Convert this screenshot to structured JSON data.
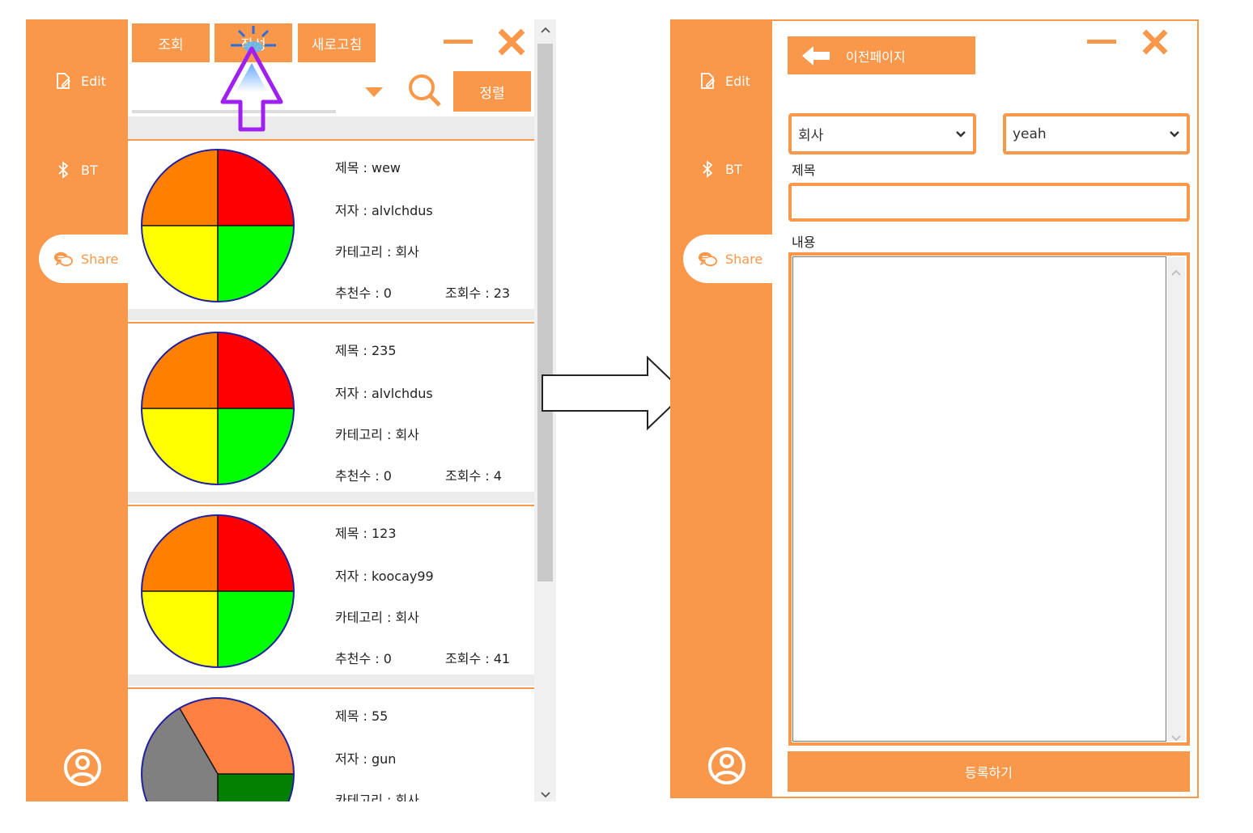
{
  "sidebar": {
    "items": [
      {
        "label": "Edit",
        "icon": "edit-icon"
      },
      {
        "label": "BT",
        "icon": "bluetooth-icon"
      },
      {
        "label": "Share",
        "icon": "chat-icon"
      }
    ]
  },
  "left_window": {
    "toolbar": {
      "view_label": "조회",
      "write_label": "작성",
      "refresh_label": "새로고침",
      "sort_label": "정렬"
    },
    "posts": [
      {
        "title": "제목 : wew",
        "author": "저자 : alvlchdus",
        "category": "카테고리 : 회사",
        "likes": "추천수 : 0",
        "views": "조회수 : 23"
      },
      {
        "title": "제목 : 235",
        "author": "저자 : alvlchdus",
        "category": "카테고리 : 회사",
        "likes": "추천수 : 0",
        "views": "조회수 : 4"
      },
      {
        "title": "제목 : 123",
        "author": "저자 : koocay99",
        "category": "카테고리 : 회사",
        "likes": "추천수 : 0",
        "views": "조회수 : 41"
      },
      {
        "title": "제목 : 55",
        "author": "저자 : gun",
        "category": "카테고리 : 회사"
      }
    ]
  },
  "right_window": {
    "back_label": "이전페이지",
    "category_value": "회사",
    "tag_value": "yeah",
    "title_label": "제목",
    "content_label": "내용",
    "submit_label": "등록하기"
  },
  "colors": {
    "accent": "#f9974a",
    "pie_red": "#ff0000",
    "pie_orange": "#ff7f00",
    "pie_yellow": "#ffff00",
    "pie_green": "#00ff00",
    "cursor": "#a020f0"
  }
}
